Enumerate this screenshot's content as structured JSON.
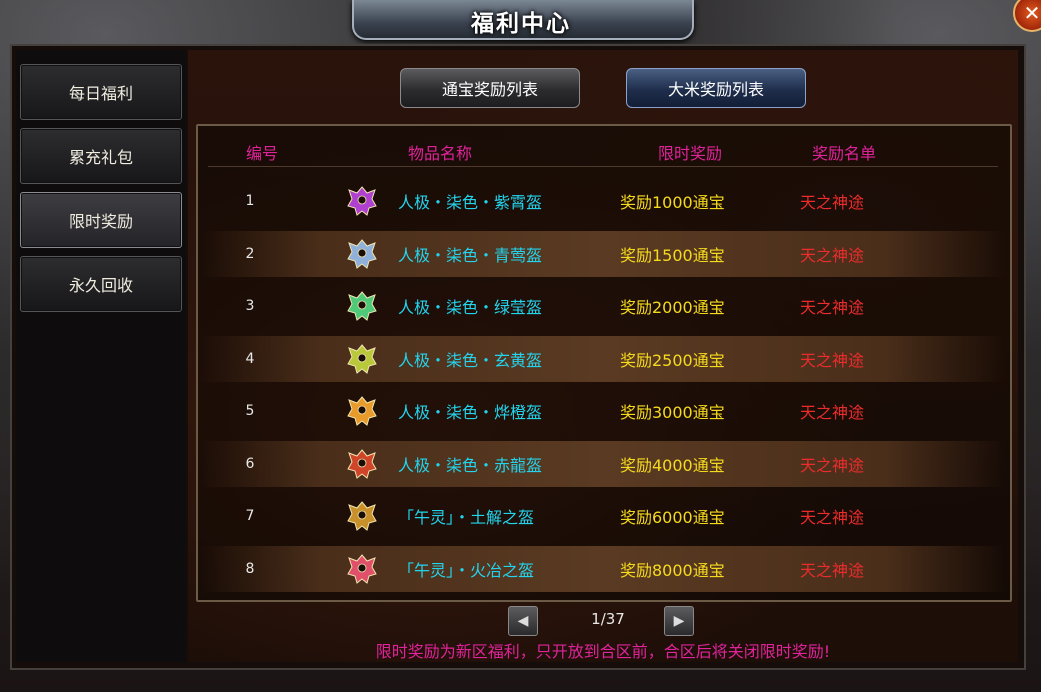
{
  "window": {
    "title": "福利中心",
    "close_label": "✕"
  },
  "sidebar": {
    "items": [
      {
        "label": "每日福利"
      },
      {
        "label": "累充礼包"
      },
      {
        "label": "限时奖励",
        "active": true
      },
      {
        "label": "永久回收"
      }
    ]
  },
  "tabs": {
    "tongbao_label": "通宝奖励列表",
    "dami_label": "大米奖励列表"
  },
  "table": {
    "headers": {
      "id": "编号",
      "name": "物品名称",
      "reward": "限时奖励",
      "rank": "奖励名单"
    },
    "rows": [
      {
        "id": "1",
        "name": "人极・柒色・紫霄盔",
        "reward": "奖励1000通宝",
        "rank": "天之神途",
        "icon": "purple-helmet-icon",
        "color": "#b040d0"
      },
      {
        "id": "2",
        "name": "人极・柒色・青莺盔",
        "reward": "奖励1500通宝",
        "rank": "天之神途",
        "icon": "silver-helmet-icon",
        "color": "#8fb0d8"
      },
      {
        "id": "3",
        "name": "人极・柒色・绿莹盔",
        "reward": "奖励2000通宝",
        "rank": "天之神途",
        "icon": "green-helmet-icon",
        "color": "#4fc87a"
      },
      {
        "id": "4",
        "name": "人极・柒色・玄黄盔",
        "reward": "奖励2500通宝",
        "rank": "天之神途",
        "icon": "yellow-green-helmet-icon",
        "color": "#b8c83a"
      },
      {
        "id": "5",
        "name": "人极・柒色・烨橙盔",
        "reward": "奖励3000通宝",
        "rank": "天之神途",
        "icon": "orange-helmet-icon",
        "color": "#e89a2a"
      },
      {
        "id": "6",
        "name": "人极・柒色・赤龍盔",
        "reward": "奖励4000通宝",
        "rank": "天之神途",
        "icon": "red-helmet-icon",
        "color": "#d0452a"
      },
      {
        "id": "7",
        "name": "「午灵」・土解之盔",
        "reward": "奖励6000通宝",
        "rank": "天之神途",
        "icon": "gold-helmet-icon",
        "color": "#c8902a"
      },
      {
        "id": "8",
        "name": "「午灵」・火冶之盔",
        "reward": "奖励8000通宝",
        "rank": "天之神途",
        "icon": "crimson-helmet-icon",
        "color": "#e0506a"
      }
    ]
  },
  "pager": {
    "prev_label": "◀",
    "next_label": "▶",
    "page_text": "1/37"
  },
  "notice": "限时奖励为新区福利，只开放到合区前，合区后将关闭限时奖励!"
}
